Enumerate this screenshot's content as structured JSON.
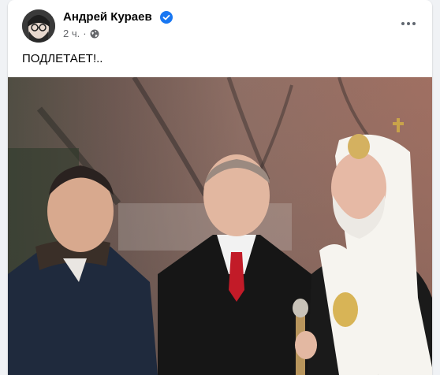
{
  "post": {
    "author": "Андрей Кураев",
    "time": "2 ч.",
    "separator": "·",
    "text": "ПОДЛЕТАЕТ!..",
    "photo_alt": "Фото"
  }
}
